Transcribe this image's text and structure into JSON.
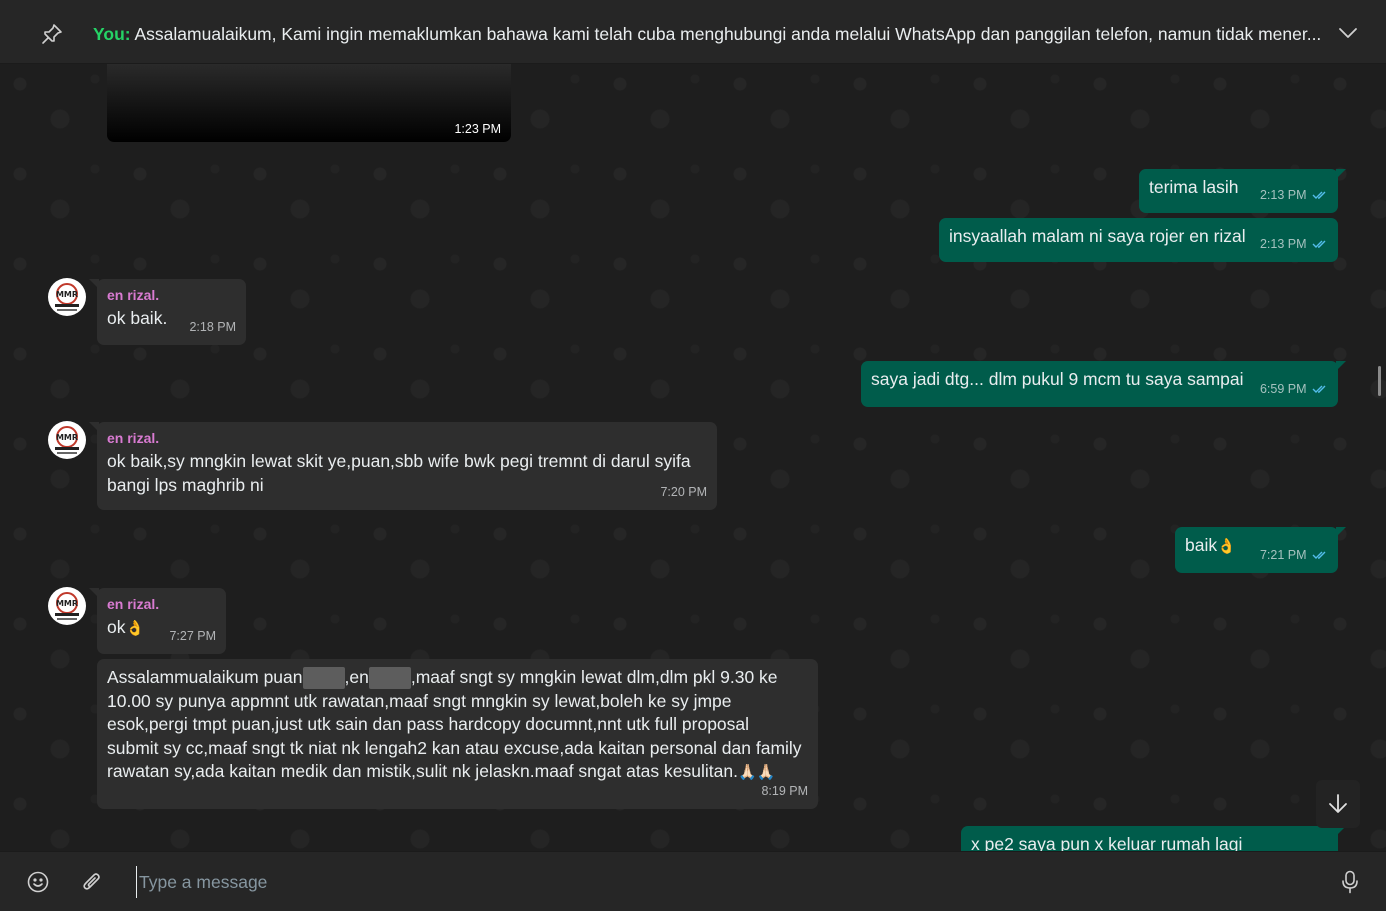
{
  "pinned": {
    "sender": "You:",
    "text": "Assalamualaikum,  Kami ingin memaklumkan bahawa kami telah cuba menghubungi anda melalui WhatsApp dan panggilan telefon, namun tidak mener..."
  },
  "messages": [
    {
      "kind": "media",
      "time": "1:23 PM"
    },
    {
      "kind": "out",
      "text": "terima lasih",
      "time": "2:13 PM"
    },
    {
      "kind": "out",
      "text": "insyaallah malam ni saya rojer en rizal",
      "time": "2:13 PM"
    },
    {
      "kind": "in",
      "sender": "en rizal.",
      "text": "ok baik.",
      "time": "2:18 PM"
    },
    {
      "kind": "out",
      "text": "saya jadi dtg... dlm pukul 9 mcm tu saya sampai",
      "time": "6:59 PM"
    },
    {
      "kind": "in",
      "sender": "en rizal.",
      "line1": "ok baik,sy mngkin lewat skit ye,puan,sbb wife bwk pegi tremnt di darul syifa",
      "line2": "bangi lps maghrib ni",
      "time": "7:20 PM"
    },
    {
      "kind": "out",
      "text": "baik",
      "emoji": "👌",
      "time": "7:21 PM"
    },
    {
      "kind": "in",
      "sender": "en rizal.",
      "text": "ok",
      "emoji": "👌",
      "time": "7:27 PM"
    },
    {
      "kind": "in",
      "part1": "Assalammualaikum puan",
      "part2": ",en",
      "part3": ",maaf sngt sy mngkin lewat dlm,dlm pkl 9.30 ke",
      "line2": "10.00  sy punya appmnt utk rawatan,maaf sngt mngkin sy lewat,boleh ke sy jmpe",
      "line3": "esok,pergi tmpt puan,just utk sain dan pass hardcopy documnt,nnt utk full proposal",
      "line4": "submit sy cc,maaf sngt tk niat nk lengah2 kan atau excuse,ada kaitan personal dan family",
      "line5": "rawatan sy,ada kaitan medik dan mistik,sulit nk jelaskn.maaf sngat atas kesulitan.",
      "emoji": "🙏🏻🙏🏻",
      "time": "8:19 PM"
    },
    {
      "kind": "out",
      "text": "x pe2 saya pun x keluar rumah lagi"
    }
  ],
  "composer": {
    "placeholder": "Type a message"
  },
  "icons": [
    "pin-icon",
    "chevron-down-icon",
    "double-check-icon",
    "arrow-down-icon",
    "emoji-icon",
    "paperclip-icon",
    "microphone-icon"
  ],
  "colors": {
    "outgoing": "#005c4b",
    "incoming": "#2e2e2e",
    "sender_name": "#d97bd2",
    "you_label": "#25d366",
    "read_ticks": "#53bdeb"
  }
}
